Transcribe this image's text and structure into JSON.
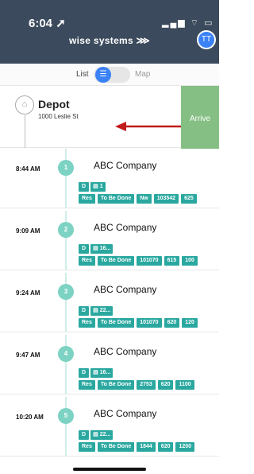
{
  "status": {
    "time": "6:04 ➚",
    "icons": "▂▄▆ ⌔ ▭"
  },
  "header": {
    "brand": "wise systems ⋙",
    "avatar": "TT"
  },
  "toggle": {
    "list_label": "List",
    "knob_icon": "☰",
    "map_label": "Map"
  },
  "depot": {
    "title": "Depot",
    "address": "1000 Leslie St",
    "arrive_label": "Arrive",
    "icon": "⌂"
  },
  "colors": {
    "header": "#3b4a5c",
    "accent": "#3b82f6",
    "teal": "#2aa8a0",
    "arrive": "#86bf84",
    "arrow": "#c11b1b"
  },
  "stops": [
    {
      "time": "8:44 AM",
      "num": "1",
      "company": "ABC Company",
      "code": "D",
      "qty": "1",
      "status": "Res",
      "state": "To Be Done",
      "c1": "Nw",
      "c2": "103542",
      "c3": "625"
    },
    {
      "time": "9:09 AM",
      "num": "2",
      "company": "ABC Company",
      "code": "D",
      "qty": "16...",
      "status": "Res",
      "state": "To Be Done",
      "c1": "101070",
      "c2": "615",
      "c3": "100"
    },
    {
      "time": "9:24 AM",
      "num": "3",
      "company": "ABC Company",
      "code": "D",
      "qty": "22...",
      "status": "Res",
      "state": "To Be Done",
      "c1": "101070",
      "c2": "620",
      "c3": "120"
    },
    {
      "time": "9:47 AM",
      "num": "4",
      "company": "ABC Company",
      "code": "D",
      "qty": "16...",
      "status": "Res",
      "state": "To Be Done",
      "c1": "2753",
      "c2": "620",
      "c3": "1100"
    },
    {
      "time": "10:20 AM",
      "num": "5",
      "company": "ABC Company",
      "code": "D",
      "qty": "22...",
      "status": "Res",
      "state": "To Be Done",
      "c1": "1844",
      "c2": "620",
      "c3": "1200"
    }
  ]
}
